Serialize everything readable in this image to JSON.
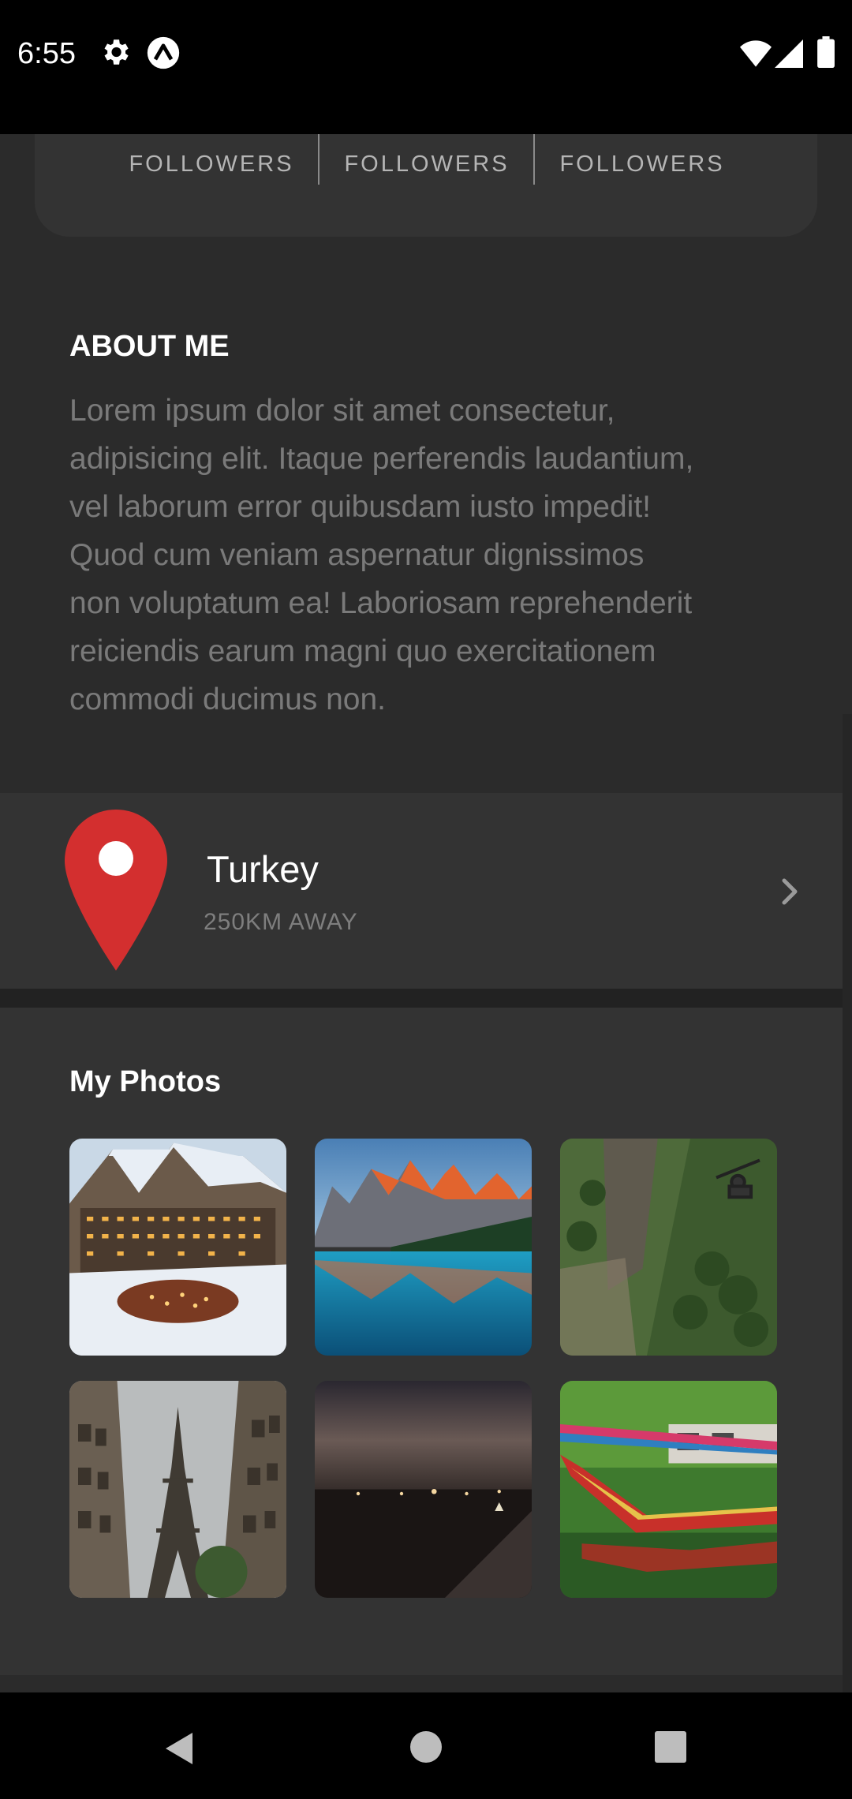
{
  "status_bar": {
    "time": "6:55",
    "icons": [
      "gear-icon",
      "expo-icon",
      "wifi-icon",
      "signal-icon",
      "battery-icon"
    ]
  },
  "stats": [
    {
      "label": "FOLLOWERS"
    },
    {
      "label": "FOLLOWERS"
    },
    {
      "label": "FOLLOWERS"
    }
  ],
  "about": {
    "title": "ABOUT ME",
    "body_lines": [
      "Lorem ipsum dolor sit amet consectetur,",
      "adipisicing elit. Itaque perferendis laudantium,",
      "vel laborum error quibusdam iusto impedit!",
      "Quod cum veniam aspernatur dignissimos",
      "non voluptatum ea! Laboriosam reprehenderit",
      "reiciendis earum magni quo exercitationem",
      "commodi ducimus non."
    ]
  },
  "location": {
    "name": "Turkey",
    "distance": "250KM AWAY",
    "icon": "map-pin-icon",
    "action_icon": "chevron-right-icon"
  },
  "photos": {
    "title": "My Photos",
    "items": [
      {
        "subject": "snowy-hotel-photo"
      },
      {
        "subject": "mountain-lake-photo"
      },
      {
        "subject": "bungee-jump-photo"
      },
      {
        "subject": "eiffel-tower-photo"
      },
      {
        "subject": "night-shoreline-photo"
      },
      {
        "subject": "longtail-boat-photo"
      }
    ]
  },
  "nav_bar": {
    "icons": [
      "back-icon",
      "home-icon",
      "recents-icon"
    ]
  },
  "colors": {
    "background": "#2b2b2b",
    "card": "#333333",
    "pin_red": "#d32f2f",
    "muted_text": "#7a7a7a"
  }
}
